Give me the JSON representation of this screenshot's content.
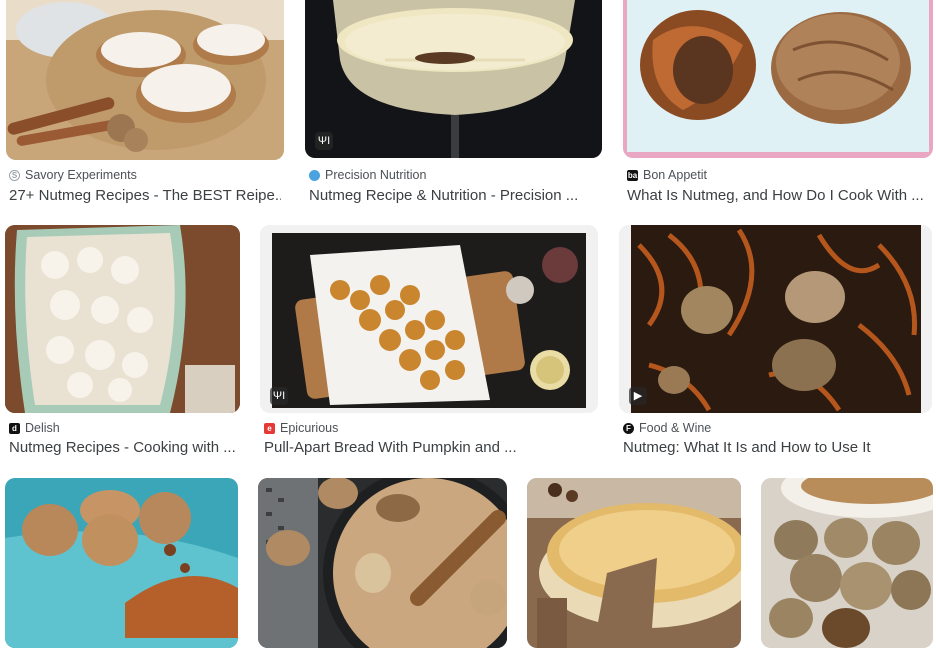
{
  "results": [
    {
      "source": "Savory Experiments",
      "title": "27+ Nutmeg Recipes - The BEST Reipe...",
      "favicon": "savory-favicon-icon",
      "image": "frosted-cookies-image",
      "colors": {
        "fav": "#9aa0a6"
      }
    },
    {
      "source": "Precision Nutrition",
      "title": "Nutmeg Recipe & Nutrition - Precision ...",
      "favicon": "precision-nutrition-favicon-icon",
      "image": "eggnog-cocktail-image",
      "badge": "recipe-icon",
      "colors": {
        "fav": "#4aa3df"
      }
    },
    {
      "source": "Bon Appetit",
      "title": "What Is Nutmeg, and How Do I Cook With ...",
      "favicon": "bon-appetit-favicon-icon",
      "image": "whole-nutmeg-image",
      "colors": {
        "fav": "#111111"
      }
    },
    {
      "source": "Delish",
      "title": "Nutmeg Recipes - Cooking with ...",
      "favicon": "delish-favicon-icon",
      "image": "creamy-potatoes-image",
      "colors": {
        "fav": "#111111"
      }
    },
    {
      "source": "Epicurious",
      "title": "Pull-Apart Bread With Pumpkin and ...",
      "favicon": "epicurious-favicon-icon",
      "image": "pull-apart-bread-image",
      "badge": "recipe-icon",
      "colors": {
        "fav": "#e53935"
      }
    },
    {
      "source": "Food & Wine",
      "title": "Nutmeg: What It Is and How to Use It",
      "favicon": "food-wine-favicon-icon",
      "image": "nutmeg-mace-image",
      "badge": "video-play-icon",
      "colors": {
        "fav": "#111111"
      }
    },
    {
      "image": "nutmeg-powder-image"
    },
    {
      "image": "grated-nutmeg-image"
    },
    {
      "image": "cheesecake-image"
    },
    {
      "image": "nutmeg-bowl-image"
    }
  ],
  "badge_glyphs": {
    "recipe": "ΨΙ",
    "video": "▶"
  },
  "favicon_glyphs": {
    "savory": "S",
    "precision": "",
    "bon": "ba",
    "delish": "d",
    "epicurious": "e",
    "foodwine": "F"
  }
}
